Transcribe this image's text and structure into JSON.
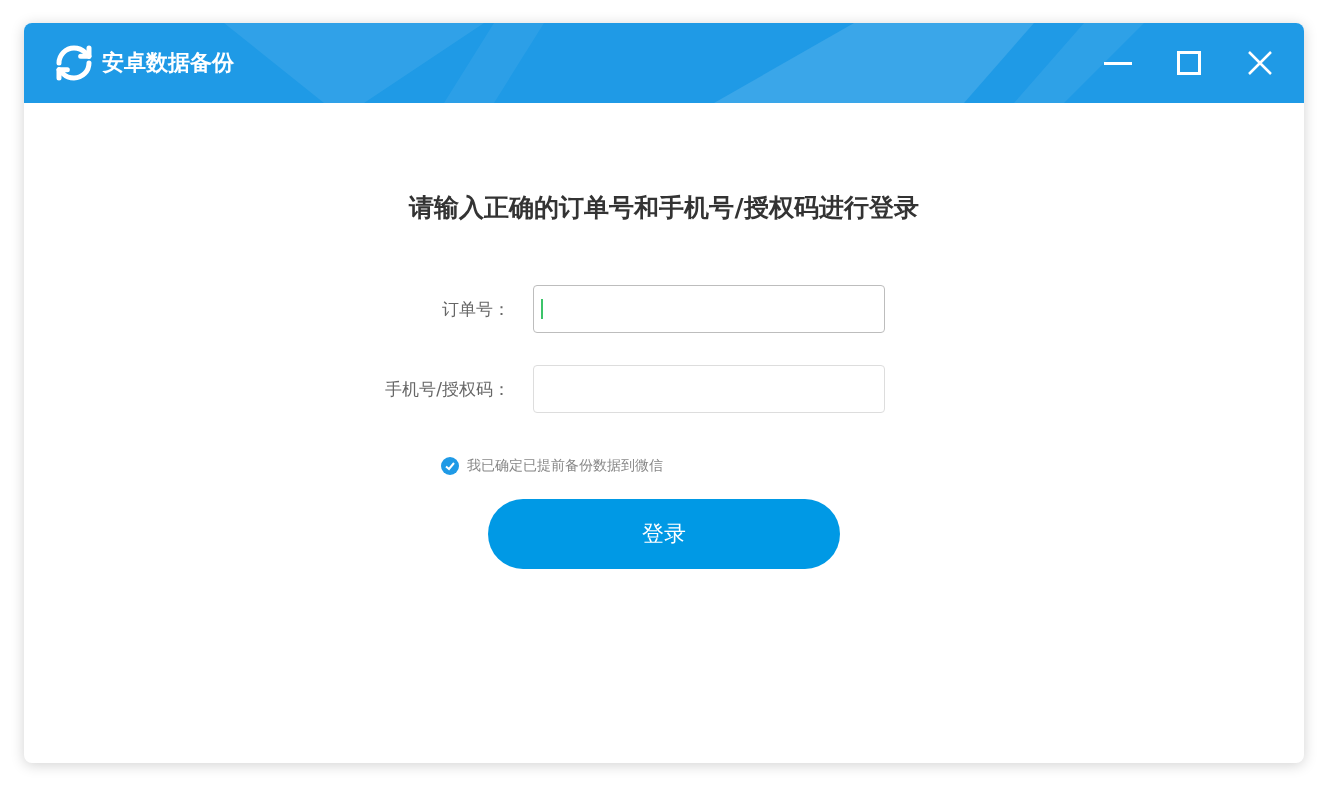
{
  "window": {
    "title": "安卓数据备份"
  },
  "heading": "请输入正确的订单号和手机号/授权码进行登录",
  "fields": [
    {
      "label": "订单号：",
      "focused": true
    },
    {
      "label": "手机号/授权码：",
      "focused": false
    }
  ],
  "agreement": {
    "label": "我已确定已提前备份数据到微信",
    "checked": true
  },
  "login_button": "登录"
}
